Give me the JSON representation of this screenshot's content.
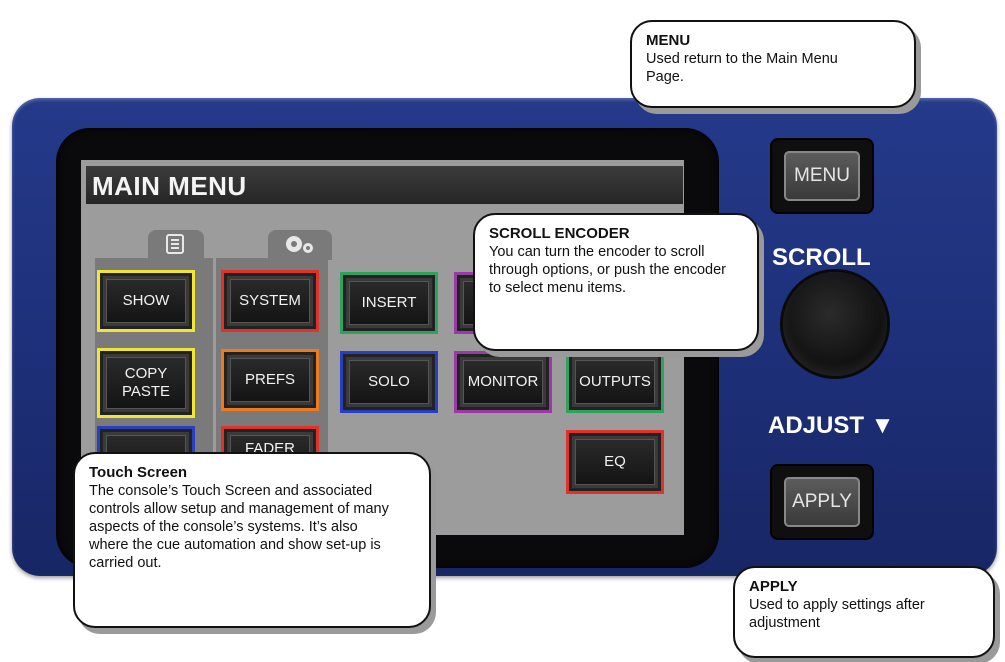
{
  "screen": {
    "title": "MAIN MENU",
    "buttons": {
      "show": "SHOW",
      "system": "SYSTEM",
      "insert": "INSERT",
      "copy_paste_line1": "COPY",
      "copy_paste_line2": "PASTE",
      "prefs": "PREFS",
      "solo": "SOLO",
      "monitor": "MONITOR",
      "outputs": "OUTPUTS",
      "fader_partial": "FADER",
      "eq": "EQ"
    },
    "colors": {
      "show": "#f1e637",
      "copy_paste": "#f1e637",
      "system": "#e0322a",
      "prefs": "#ee7a1e",
      "fader": "#e0322a",
      "insert": "#2fa35c",
      "outputs": "#2fa35c",
      "solo": "#2a3ec0",
      "monitor": "#9a3aa5",
      "eq": "#e0322a"
    },
    "tab_icons": [
      "list-icon",
      "gears-icon"
    ]
  },
  "hardware": {
    "menu_button": "MENU",
    "apply_button": "APPLY",
    "scroll_label": "SCROLL",
    "adjust_label": "ADJUST ▼",
    "panel_color": "#1d2f78"
  },
  "callouts": {
    "menu": {
      "title": "MENU",
      "body": "Used return to the Main Menu Page."
    },
    "scroll": {
      "title": "SCROLL ENCODER",
      "body": "You can turn the encoder to scroll through options, or push the encoder to select menu items."
    },
    "touch": {
      "title": "Touch Screen",
      "body": "The console’s Touch Screen and associated controls allow setup and management of many aspects of the console’s systems. It’s also where the cue automation and show set-up is carried out."
    },
    "apply": {
      "title": "APPLY",
      "body": "Used to apply settings after adjustment"
    }
  }
}
